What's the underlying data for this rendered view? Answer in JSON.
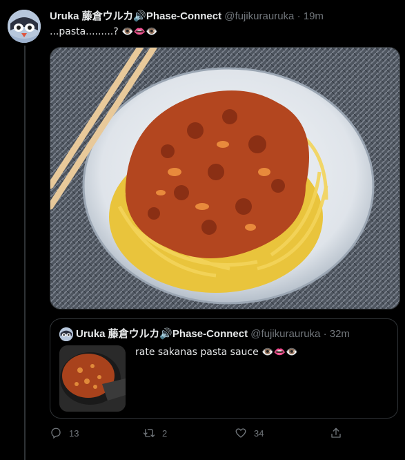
{
  "tweet": {
    "author_name": "Uruka 藤倉ウルカ🔊Phase-Connect",
    "handle": "@fujikurauruka",
    "separator": "·",
    "time": "19m",
    "text": "...pasta.........? 👁️👄👁️",
    "media_icon": "spaghetti-bolognese-photo"
  },
  "quote": {
    "author_name": "Uruka 藤倉ウルカ🔊Phase-Connect",
    "handle": "@fujikurauruka",
    "separator": "·",
    "time": "32m",
    "text": "rate sakanas pasta sauce 👁️👄👁️",
    "media_icon": "pasta-sauce-pan-photo"
  },
  "actions": {
    "reply_count": "13",
    "retweet_count": "2",
    "like_count": "34",
    "share_icon": "share-icon"
  },
  "colors": {
    "background": "#000000",
    "text_primary": "#e7e9ea",
    "text_secondary": "#71767b",
    "border": "#2f3336"
  }
}
